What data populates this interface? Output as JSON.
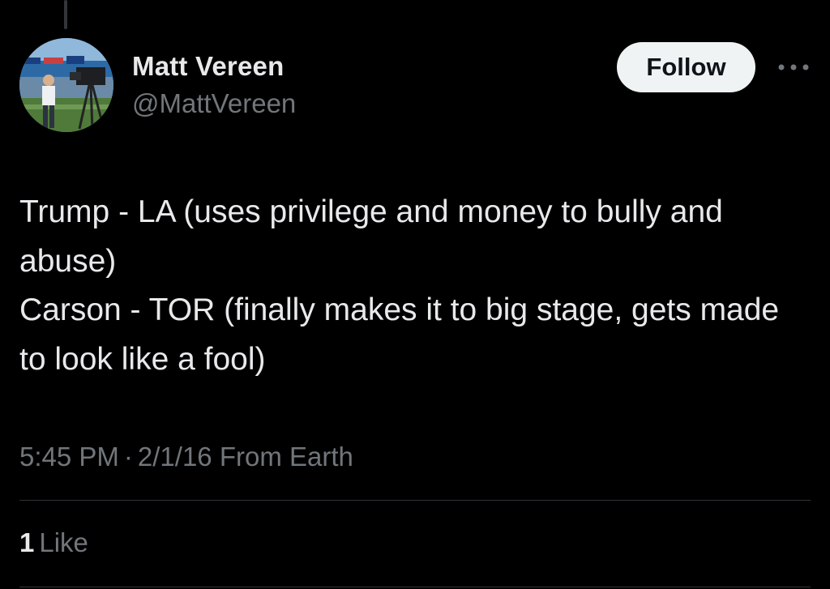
{
  "author": {
    "display_name": "Matt Vereen",
    "handle": "@MattVereen"
  },
  "follow_label": "Follow",
  "more_icon": "more-horizontal-icon",
  "tweet": {
    "lines": [
      "Trump - LA (uses privilege and money to bully and abuse)",
      "Carson - TOR (finally makes it to big stage, gets made to look like a fool)"
    ],
    "time": "5:45 PM",
    "date": "2/1/16",
    "source": "From Earth"
  },
  "stats": {
    "like_count": "1",
    "like_label": "Like"
  },
  "colors": {
    "background": "#000000",
    "primary_text": "#e7e9ea",
    "secondary_text": "#71767b",
    "follow_button_bg": "#eff3f4",
    "divider": "#2f3336"
  }
}
